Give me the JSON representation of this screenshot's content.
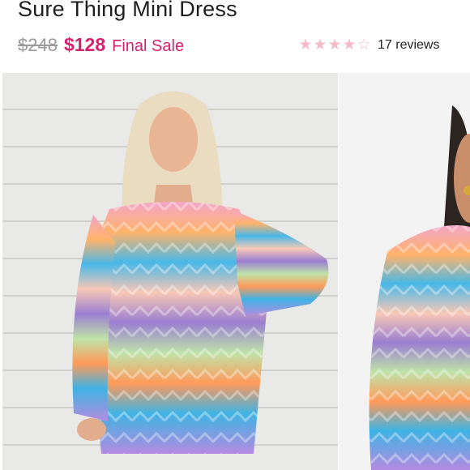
{
  "product": {
    "title": "Sure Thing Mini Dress",
    "price_original": "$248",
    "price_sale": "$128",
    "sale_label": "Final Sale"
  },
  "rating": {
    "value": 4,
    "max": 5,
    "reviews_text": "17 reviews",
    "star_color": "#f4bcc9"
  },
  "gallery": {
    "images": [
      {
        "alt": "model-front-photo"
      },
      {
        "alt": "model-side-photo"
      }
    ]
  },
  "colors": {
    "sale_accent": "#d61f6f",
    "strike_price": "#9a9a9a"
  }
}
